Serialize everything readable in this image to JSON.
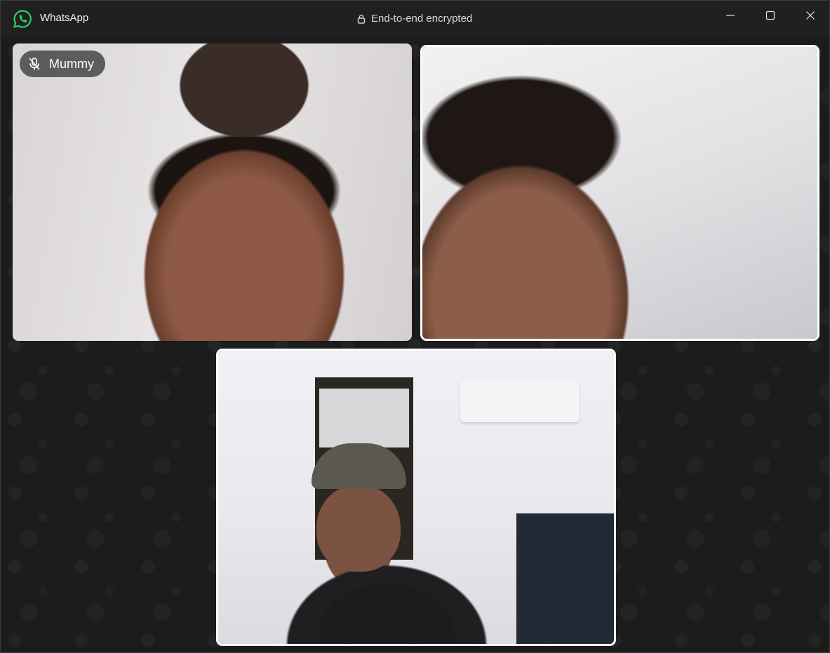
{
  "window": {
    "app_title": "WhatsApp",
    "encryption_status": "End-to-end encrypted",
    "controls": [
      "minimize-icon",
      "maximize-icon",
      "close-icon"
    ]
  },
  "call": {
    "participants": [
      {
        "name": "Mummy",
        "muted": true,
        "mic_icon": "mic-off-icon"
      },
      {
        "name": "",
        "muted": false
      },
      {
        "name": "",
        "muted": false,
        "is_self": true
      }
    ]
  },
  "colors": {
    "background": "#1e1e1e",
    "titlebar": "#202020",
    "active_border": "#ffffff",
    "brand": "#25d366"
  }
}
